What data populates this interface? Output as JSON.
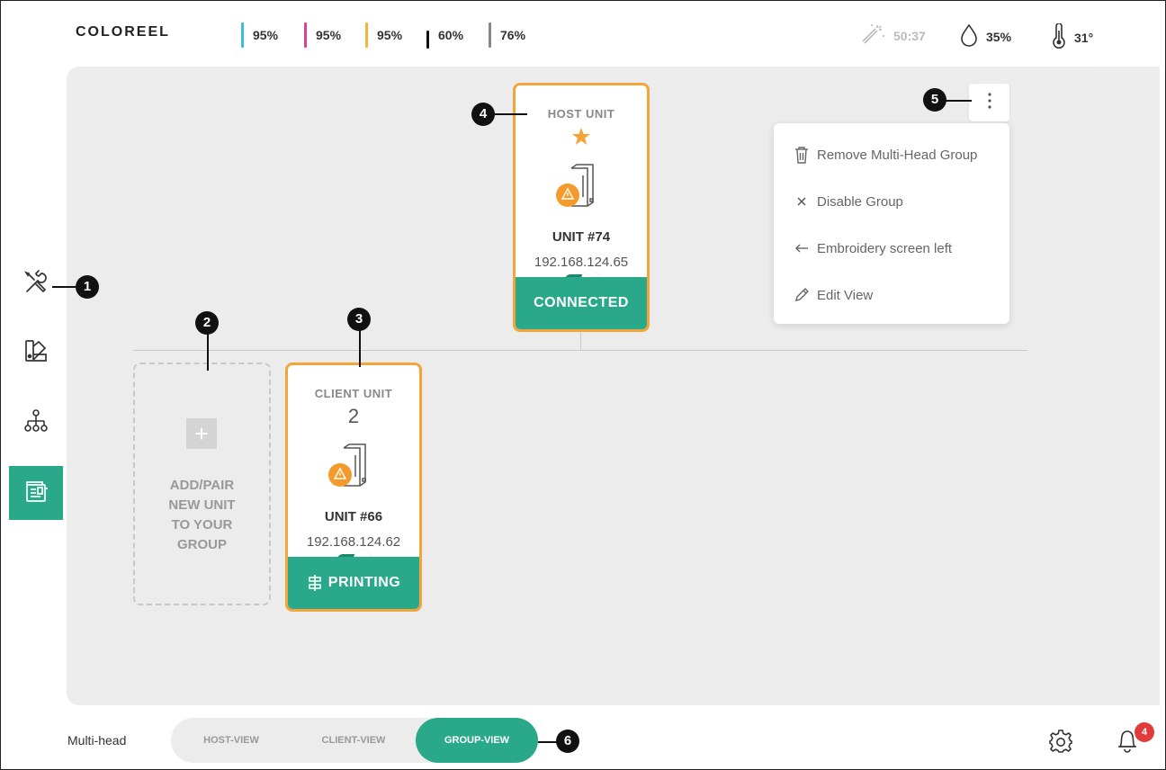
{
  "brand": "COLOREEL",
  "inks": [
    {
      "value": "95%",
      "color": "#3bbfd6"
    },
    {
      "value": "95%",
      "color": "#d8409e"
    },
    {
      "value": "95%",
      "color": "#f3b43a"
    },
    {
      "value": "60%",
      "color": "#111111"
    },
    {
      "value": "76%",
      "color": "#888888"
    }
  ],
  "status_bar": {
    "timer": "50:37",
    "humidity": "35%",
    "temperature": "31°"
  },
  "host_card": {
    "role": "HOST UNIT",
    "unit_name": "UNIT #74",
    "ip": "192.168.124.65",
    "status": "CONNECTED",
    "toggle_on": true
  },
  "client_card": {
    "role": "CLIENT UNIT",
    "number": "2",
    "unit_name": "UNIT #66",
    "ip": "192.168.124.62",
    "status": "PRINTING",
    "toggle_on": true
  },
  "add_card": {
    "lines": [
      "ADD/PAIR",
      "NEW UNIT",
      "TO YOUR",
      "GROUP"
    ]
  },
  "menu": {
    "items": [
      {
        "label": "Remove Multi-Head Group",
        "icon": "trash-icon"
      },
      {
        "label": "Disable Group",
        "icon": "close-icon"
      },
      {
        "label": "Embroidery screen left",
        "icon": "arrow-left-icon"
      },
      {
        "label": "Edit View",
        "icon": "pencil-icon"
      }
    ]
  },
  "callouts": [
    "1",
    "2",
    "3",
    "4",
    "5",
    "6"
  ],
  "bottom_bar": {
    "label": "Multi-head",
    "tabs": [
      "HOST-VIEW",
      "CLIENT-VIEW",
      "GROUP-VIEW"
    ],
    "active_tab": "GROUP-VIEW",
    "notification_count": "4"
  },
  "sidebar": {
    "items": [
      "tools-icon",
      "palette-icon",
      "hierarchy-icon",
      "embroidery-machine-icon"
    ],
    "active": "embroidery-machine-icon"
  },
  "colors": {
    "accent": "#2aa98a",
    "card_border": "#f3a53a",
    "warning": "#f39a2a"
  }
}
